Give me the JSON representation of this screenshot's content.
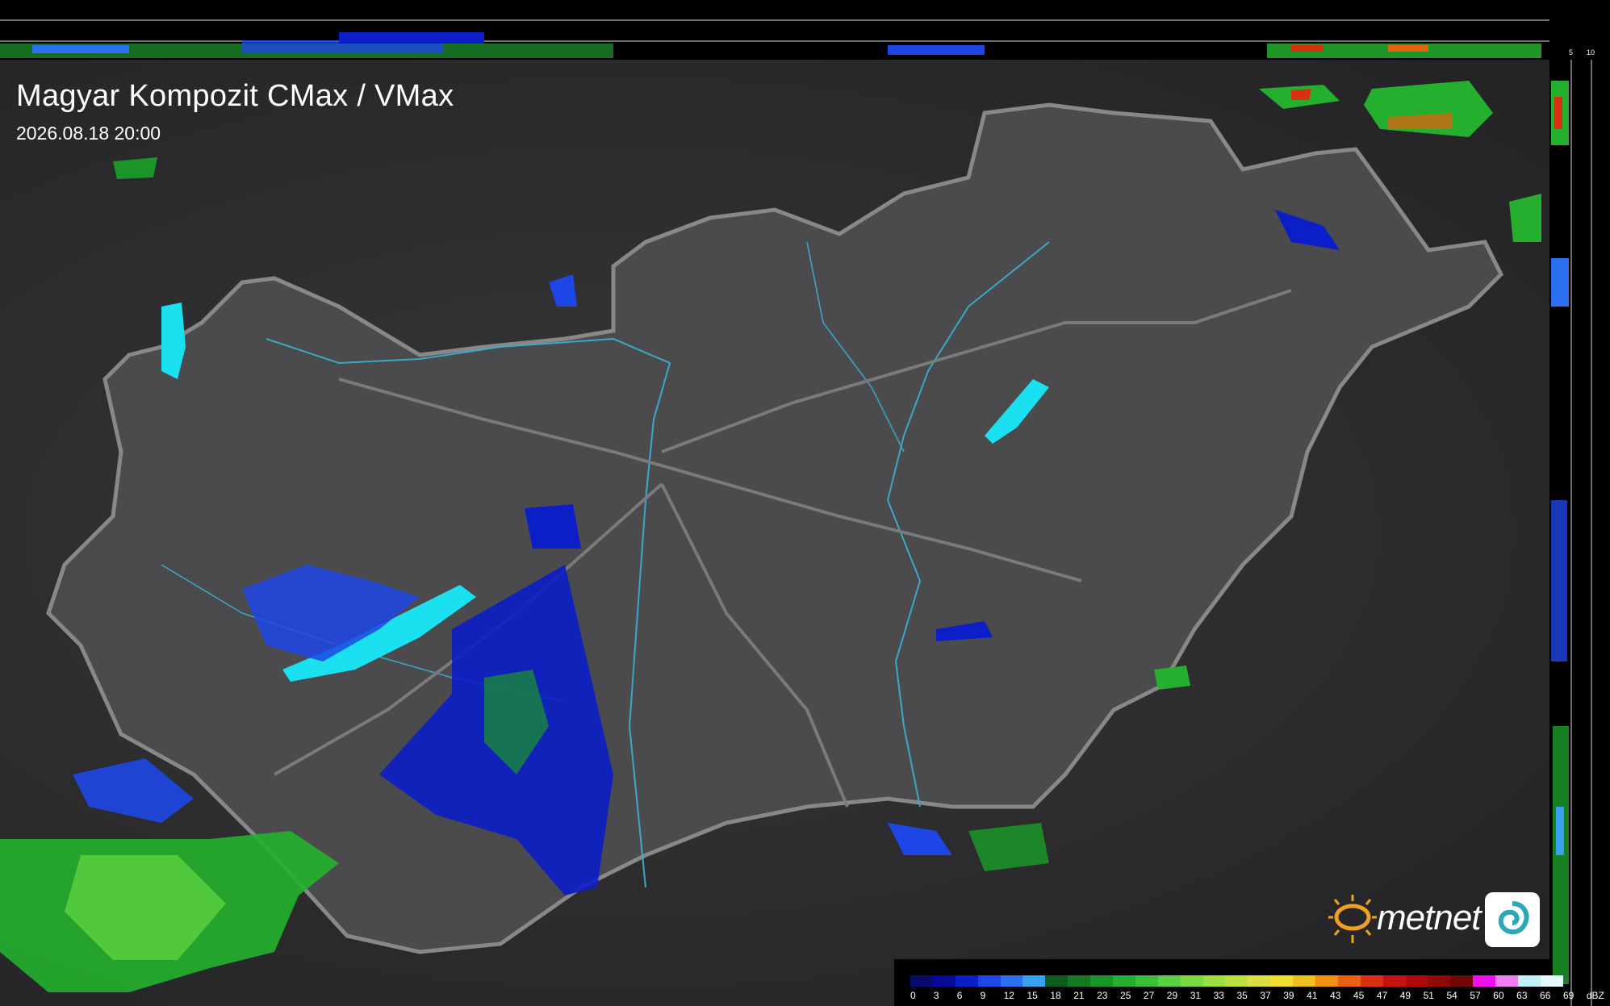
{
  "title": "Magyar Kompozit CMax / VMax",
  "timestamp": "2026.08.18 20:00",
  "logo": {
    "text": "metnet"
  },
  "scale_labels": {
    "top_10": "10",
    "top_5": "5",
    "right_5": "5",
    "right_10": "10"
  },
  "legend": {
    "unit": "dBZ",
    "values": [
      "0",
      "3",
      "6",
      "9",
      "12",
      "15",
      "18",
      "21",
      "23",
      "25",
      "27",
      "29",
      "31",
      "33",
      "35",
      "37",
      "39",
      "41",
      "43",
      "45",
      "47",
      "49",
      "51",
      "54",
      "57",
      "60",
      "63",
      "66",
      "69"
    ],
    "colors": [
      "#0a0a6e",
      "#0a0a9a",
      "#0b1ec8",
      "#1e46e6",
      "#2a70f0",
      "#3aa0f0",
      "#0f5a1e",
      "#137a22",
      "#1a9628",
      "#24b02e",
      "#3cc03a",
      "#5ad040",
      "#7ad840",
      "#9ae040",
      "#bae040",
      "#dae040",
      "#f0e030",
      "#f0c020",
      "#f09010",
      "#e86010",
      "#d83010",
      "#c81010",
      "#b00a0a",
      "#900808",
      "#700606",
      "#f010f0",
      "#f080f0",
      "#c0f0f8",
      "#e8f8ff"
    ]
  }
}
